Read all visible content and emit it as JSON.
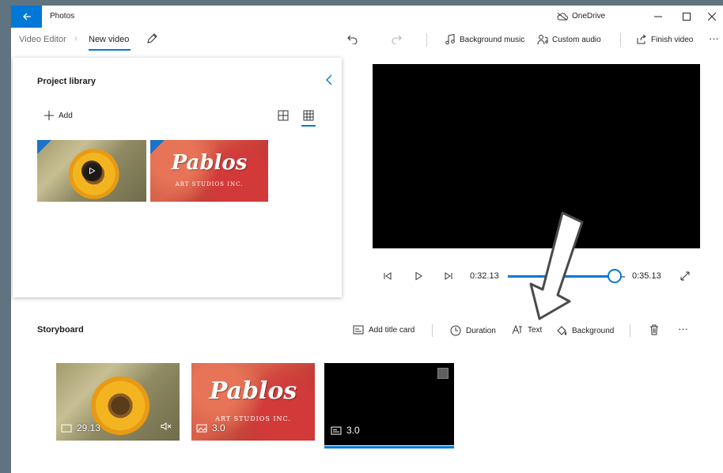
{
  "titlebar": {
    "app_name": "Photos",
    "onedrive_label": "OneDrive"
  },
  "breadcrumb": {
    "root": "Video Editor",
    "current": "New video"
  },
  "toolbar": {
    "background_music": "Background music",
    "custom_audio": "Custom audio",
    "finish_video": "Finish video",
    "more": "···"
  },
  "library": {
    "title": "Project library",
    "add_label": "Add",
    "items": [
      {
        "name": "sunflower-video",
        "kind": "video"
      },
      {
        "name": "pablos-image",
        "kind": "image",
        "logo": "Pablos",
        "subtitle": "ART STUDIOS INC."
      }
    ]
  },
  "player": {
    "current_time": "0:32.13",
    "total_time": "0:35.13",
    "progress": 0.914
  },
  "storyboard": {
    "title": "Storyboard",
    "add_title_card": "Add title card",
    "duration": "Duration",
    "text": "Text",
    "background": "Background",
    "more": "···",
    "clips": [
      {
        "kind": "video",
        "duration": "29.13",
        "muted": true
      },
      {
        "kind": "image",
        "duration": "3.0",
        "logo": "Pablos",
        "subtitle": "ART STUDIOS INC."
      },
      {
        "kind": "title-card",
        "duration": "3.0",
        "selected": true
      }
    ]
  },
  "colors": {
    "accent": "#0078d7",
    "desktop": "#5f7380"
  }
}
